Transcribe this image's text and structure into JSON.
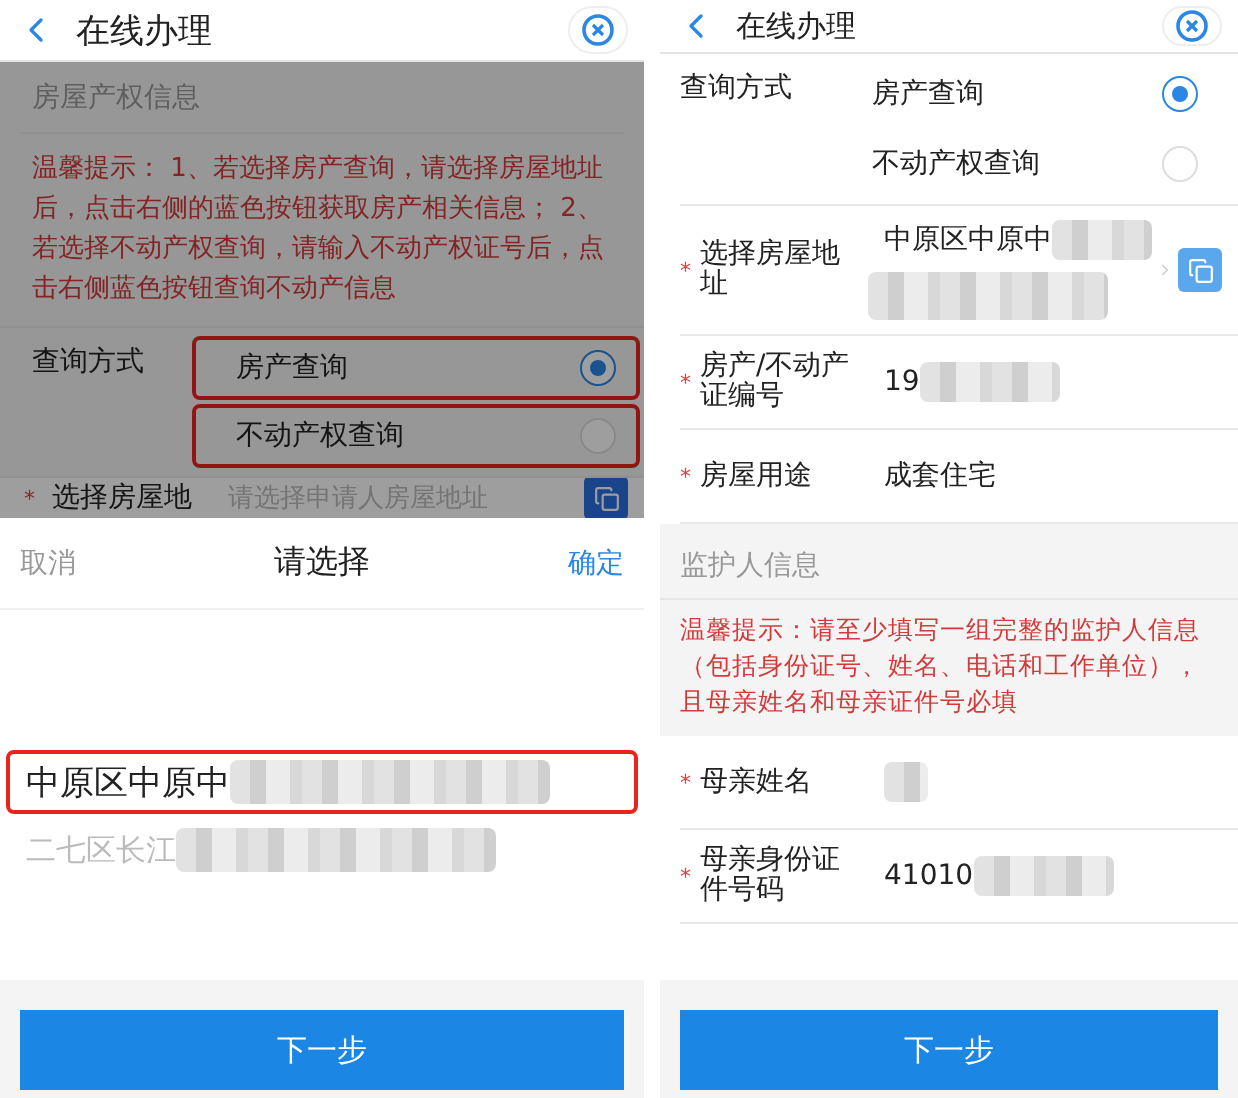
{
  "left_screen": {
    "header": {
      "title": "在线办理"
    },
    "form": {
      "dimmed": true,
      "section_title": "房屋产权信息",
      "notice": "温馨提示： 1、若选择房产查询，请选择房屋地址后，点击右侧的蓝色按钮获取房产相关信息； 2、若选择不动产权查询，请输入不动产权证号后，点击右侧蓝色按钮查询不动产信息",
      "query": {
        "label": "查询方式",
        "options": [
          {
            "label": "房产查询",
            "selected": true,
            "highlighted": true
          },
          {
            "label": "不动产权查询",
            "selected": false,
            "highlighted": true
          }
        ]
      },
      "address": {
        "required_mark": "*",
        "label": "选择房屋地",
        "placeholder": "请选择申请人房屋地址"
      }
    },
    "picker": {
      "cancel": "取消",
      "title": "请选择",
      "confirm": "确定",
      "options": [
        {
          "text": "中原区中原中",
          "selected": true,
          "highlighted": true
        },
        {
          "text": "二七区长江",
          "selected": false,
          "highlighted": false
        }
      ]
    },
    "next_button": "下一步"
  },
  "right_screen": {
    "header": {
      "title": "在线办理"
    },
    "query": {
      "label": "查询方式",
      "options": [
        {
          "label": "房产查询",
          "selected": true
        },
        {
          "label": "不动产权查询",
          "selected": false
        }
      ]
    },
    "fields": [
      {
        "kind": "address",
        "required_mark": "*",
        "label": "选择房屋地址",
        "value": "中原区中原中",
        "masked": true
      },
      {
        "kind": "text",
        "required_mark": "*",
        "label": "房产/不动产证编号",
        "value": "19",
        "masked": true
      },
      {
        "kind": "text",
        "required_mark": "*",
        "label": "房屋用途",
        "value": "成套住宅",
        "masked": false
      }
    ],
    "section_title": "监护人信息",
    "notice": "温馨提示：请至少填写一组完整的监护人信息（包括身份证号、姓名、电话和工作单位），且母亲姓名和母亲证件号必填",
    "guardian_fields": [
      {
        "required_mark": "*",
        "label": "母亲姓名",
        "masked": true
      },
      {
        "required_mark": "*",
        "label": "母亲身份证件号码",
        "value": "41010",
        "masked": true
      }
    ],
    "next_button": "下一步"
  }
}
